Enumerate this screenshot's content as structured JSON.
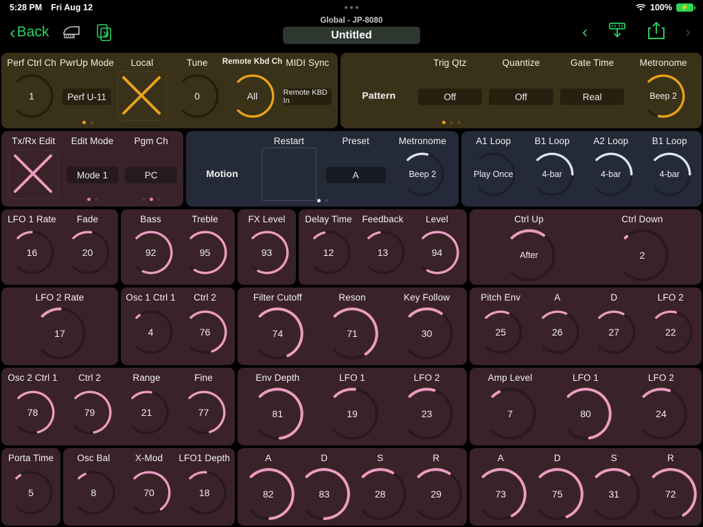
{
  "status_bar": {
    "time": "5:28 PM",
    "date": "Fri Aug 12",
    "battery_percent": "100%",
    "wifi_icon": "wifi-icon",
    "battery_icon": "battery-charging-icon"
  },
  "nav": {
    "back_label": "Back",
    "back_icon": "chevron-left-icon",
    "piano_icon": "piano-icon",
    "copy_icon": "document-copy-icon",
    "prev_icon": "chevron-left-icon",
    "import_icon": "import-download-icon",
    "share_icon": "share-upload-icon",
    "next_icon": "chevron-right-icon"
  },
  "title": {
    "subtitle": "Global - JP-8080",
    "name": "Untitled"
  },
  "colors": {
    "accent_green": "#2ad464",
    "amber": "#e8a31a",
    "pink": "#eb9dbf",
    "pink_bright": "#f0a0c4",
    "white_arc": "#e9ecf2",
    "panel_amber": "#3a3119",
    "panel_dark": "#3a2229",
    "panel_navy": "#242a38"
  },
  "panels": [
    {
      "id": "midi-global",
      "theme": "amber",
      "dots": {
        "count": 2,
        "active": 0
      },
      "controls": [
        {
          "type": "knob",
          "label": "Perf Ctrl Ch",
          "value": "1",
          "pct": 0
        },
        {
          "type": "pill",
          "label": "PwrUp Mode",
          "value": "Perf U-11"
        },
        {
          "type": "xbox",
          "label": "Local"
        },
        {
          "type": "knob",
          "label": "Tune",
          "value": "0",
          "pct": 0
        },
        {
          "type": "knob",
          "label": "Remote Kbd Ch",
          "value": "All",
          "pct": 100,
          "label_small": true
        },
        {
          "type": "pill",
          "label": "MIDI Sync",
          "value": "Remote KBD In",
          "value_small": true
        }
      ]
    },
    {
      "id": "pattern",
      "theme": "amber",
      "dots": {
        "count": 3,
        "active": 0
      },
      "controls": [
        {
          "type": "text",
          "label": "",
          "value": "Pattern"
        },
        {
          "type": "pill",
          "label": "Trig Qtz",
          "value": "Off"
        },
        {
          "type": "pill",
          "label": "Quantize",
          "value": "Off"
        },
        {
          "type": "pill",
          "label": "Gate Time",
          "value": "Real"
        },
        {
          "type": "knob",
          "label": "Metronome",
          "value": "Beep 2",
          "pct": 88
        }
      ]
    },
    {
      "id": "txrx",
      "theme": "dark",
      "controls": [
        {
          "type": "xbox",
          "label": "Tx/Rx Edit"
        },
        {
          "type": "pill",
          "label": "Edit Mode",
          "value": "Mode 1",
          "dots": {
            "count": 2,
            "active": 0
          }
        },
        {
          "type": "pill",
          "label": "Pgm Ch",
          "value": "PC",
          "dots": {
            "count": 3,
            "active": 1
          }
        }
      ]
    },
    {
      "id": "motion",
      "theme": "navy",
      "dots": {
        "count": 2,
        "active": 0
      },
      "controls": [
        {
          "type": "text",
          "value": "Motion"
        },
        {
          "type": "obox",
          "label": "Restart"
        },
        {
          "type": "pill",
          "label": "Preset",
          "value": "A"
        },
        {
          "type": "knob",
          "label": "Metronome",
          "value": "Beep 2",
          "pct": 22,
          "arc": "white"
        }
      ]
    },
    {
      "id": "loops",
      "theme": "navy",
      "controls": [
        {
          "type": "knob",
          "label": "A1 Loop",
          "value": "Play Once",
          "pct": 0,
          "arc": "white"
        },
        {
          "type": "knob",
          "label": "B1 Loop",
          "value": "4-bar",
          "pct": 50,
          "arc": "white"
        },
        {
          "type": "knob",
          "label": "A2 Loop",
          "value": "4-bar",
          "pct": 50,
          "arc": "white"
        },
        {
          "type": "knob",
          "label": "B1 Loop",
          "value": "4-bar",
          "pct": 50,
          "arc": "white"
        }
      ]
    },
    {
      "id": "lfo1",
      "theme": "dark",
      "controls": [
        {
          "type": "knob",
          "label": "LFO 1 Rate",
          "value": "16",
          "pct": 16
        },
        {
          "type": "knob",
          "label": "Fade",
          "value": "20",
          "pct": 20
        }
      ]
    },
    {
      "id": "tone",
      "theme": "dark",
      "controls": [
        {
          "type": "knob",
          "label": "Bass",
          "value": "92",
          "pct": 92
        },
        {
          "type": "knob",
          "label": "Treble",
          "value": "95",
          "pct": 95
        }
      ]
    },
    {
      "id": "fx",
      "theme": "dark",
      "controls": [
        {
          "type": "knob",
          "label": "FX Level",
          "value": "93",
          "pct": 93
        }
      ]
    },
    {
      "id": "delay",
      "theme": "dark",
      "controls": [
        {
          "type": "knob",
          "label": "Delay Time",
          "value": "12",
          "pct": 12
        },
        {
          "type": "knob",
          "label": "Feedback",
          "value": "13",
          "pct": 13
        },
        {
          "type": "knob",
          "label": "Level",
          "value": "94",
          "pct": 94
        }
      ]
    },
    {
      "id": "ctrl-updown",
      "theme": "dark",
      "controls": [
        {
          "type": "knob",
          "label": "Ctrl Up",
          "value": "After",
          "pct": 30,
          "big": true
        },
        {
          "type": "knob",
          "label": "Ctrl Down",
          "value": "2",
          "pct": 2,
          "big": true
        }
      ]
    },
    {
      "id": "lfo2",
      "theme": "dark",
      "controls": [
        {
          "type": "knob",
          "label": "LFO 2 Rate",
          "value": "17",
          "pct": 17,
          "big": true
        }
      ]
    },
    {
      "id": "osc1",
      "theme": "dark",
      "controls": [
        {
          "type": "knob",
          "label": "Osc 1 Ctrl 1",
          "value": "4",
          "pct": 4
        },
        {
          "type": "knob",
          "label": "Ctrl 2",
          "value": "76",
          "pct": 76
        }
      ]
    },
    {
      "id": "filter",
      "theme": "dark",
      "controls": [
        {
          "type": "knob",
          "label": "Filter Cutoff",
          "value": "74",
          "pct": 74,
          "big": true
        },
        {
          "type": "knob",
          "label": "Reson",
          "value": "71",
          "pct": 71,
          "big": true
        },
        {
          "type": "knob",
          "label": "Key Follow",
          "value": "30",
          "pct": 30,
          "big": true
        }
      ]
    },
    {
      "id": "pitch-env",
      "theme": "dark",
      "controls": [
        {
          "type": "knob",
          "label": "Pitch Env",
          "value": "25",
          "pct": 25
        },
        {
          "type": "knob",
          "label": "A",
          "value": "26",
          "pct": 26
        },
        {
          "type": "knob",
          "label": "D",
          "value": "27",
          "pct": 27
        },
        {
          "type": "knob",
          "label": "LFO 2",
          "value": "22",
          "pct": 22
        }
      ]
    },
    {
      "id": "osc2",
      "theme": "dark",
      "controls": [
        {
          "type": "knob",
          "label": "Osc 2 Ctrl 1",
          "value": "78",
          "pct": 78
        },
        {
          "type": "knob",
          "label": "Ctrl 2",
          "value": "79",
          "pct": 79
        },
        {
          "type": "knob",
          "label": "Range",
          "value": "21",
          "pct": 21
        },
        {
          "type": "knob",
          "label": "Fine",
          "value": "77",
          "pct": 77
        }
      ]
    },
    {
      "id": "filter-env-depth",
      "theme": "dark",
      "controls": [
        {
          "type": "knob",
          "label": "Env Depth",
          "value": "81",
          "pct": 81,
          "big": true
        },
        {
          "type": "knob",
          "label": "LFO 1",
          "value": "19",
          "pct": 19,
          "big": true
        },
        {
          "type": "knob",
          "label": "LFO 2",
          "value": "23",
          "pct": 23,
          "big": true
        }
      ]
    },
    {
      "id": "amp",
      "theme": "dark",
      "controls": [
        {
          "type": "knob",
          "label": "Amp Level",
          "value": "7",
          "pct": 7,
          "big": true
        },
        {
          "type": "knob",
          "label": "LFO 1",
          "value": "80",
          "pct": 80,
          "big": true
        },
        {
          "type": "knob",
          "label": "LFO 2",
          "value": "24",
          "pct": 24,
          "big": true
        }
      ]
    },
    {
      "id": "porta",
      "theme": "dark",
      "controls": [
        {
          "type": "knob",
          "label": "Porta Time",
          "value": "5",
          "pct": 5
        }
      ]
    },
    {
      "id": "oscmix",
      "theme": "dark",
      "controls": [
        {
          "type": "knob",
          "label": "Osc Bal",
          "value": "8",
          "pct": 8
        },
        {
          "type": "knob",
          "label": "X-Mod",
          "value": "70",
          "pct": 70
        },
        {
          "type": "knob",
          "label": "LFO1 Depth",
          "value": "18",
          "pct": 18
        }
      ]
    },
    {
      "id": "filter-adsr",
      "theme": "dark",
      "controls": [
        {
          "type": "knob",
          "label": "A",
          "value": "82",
          "pct": 82,
          "big": true
        },
        {
          "type": "knob",
          "label": "D",
          "value": "83",
          "pct": 83,
          "big": true
        },
        {
          "type": "knob",
          "label": "S",
          "value": "28",
          "pct": 28,
          "big": true
        },
        {
          "type": "knob",
          "label": "R",
          "value": "29",
          "pct": 29,
          "big": true
        }
      ]
    },
    {
      "id": "amp-adsr",
      "theme": "dark",
      "controls": [
        {
          "type": "knob",
          "label": "A",
          "value": "73",
          "pct": 73,
          "big": true
        },
        {
          "type": "knob",
          "label": "D",
          "value": "75",
          "pct": 75,
          "big": true
        },
        {
          "type": "knob",
          "label": "S",
          "value": "31",
          "pct": 31,
          "big": true
        },
        {
          "type": "knob",
          "label": "R",
          "value": "72",
          "pct": 72,
          "big": true
        }
      ]
    }
  ]
}
